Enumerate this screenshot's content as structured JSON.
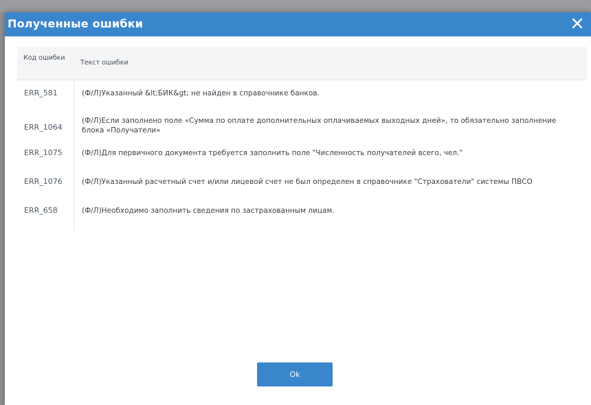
{
  "dialog": {
    "title": "Полученные ошибки",
    "close_icon": "close-icon"
  },
  "table": {
    "headers": {
      "code": "Код ошибки",
      "text": "Текст ошибки"
    },
    "rows": [
      {
        "code": "ERR_581",
        "text": "(Ф/Л)Указанный &lt;БИК&gt; не найден в справочнике банков."
      },
      {
        "code": "ERR_1064",
        "text": "(Ф/Л)Если заполнено поле «Сумма по оплате дополнительных оплачиваемых выходных дней», то обязательно заполнение блока «Получатели»"
      },
      {
        "code": "ERR_1075",
        "text": "(Ф/Л)Для первичного документа требуется заполнить поле \"Численность получателей всего, чел.\""
      },
      {
        "code": "ERR_1076",
        "text": "(Ф/Л)Указанный расчетный счет и/или лицевой счет не был определен в справочнике \"Страхователи\" системы ПВСО"
      },
      {
        "code": "ERR_658",
        "text": "(Ф/Л)Необходимо заполнить сведения по застрахованным лицам."
      }
    ]
  },
  "actions": {
    "ok_label": "Ok"
  },
  "colors": {
    "accent": "#3a86cd",
    "header_bg": "#f4f5f6"
  }
}
